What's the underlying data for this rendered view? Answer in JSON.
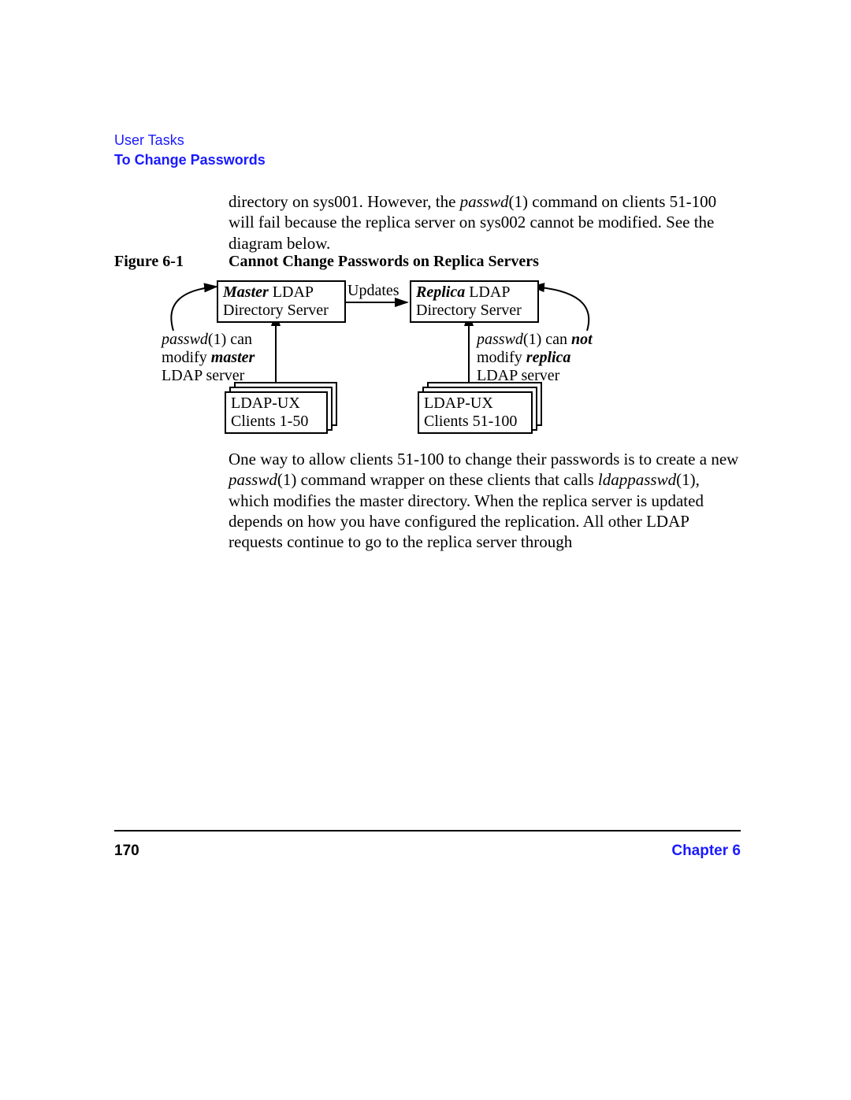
{
  "header": {
    "section": "User Tasks",
    "subsection": "To Change Passwords"
  },
  "paragraph1": {
    "pre": "directory on sys001. However, the ",
    "cmd": "passwd",
    "post_cmd": "(1) command on clients 51-100 will fail because the replica server on sys002 cannot be modified. See the diagram below."
  },
  "figure": {
    "label": "Figure 6-1",
    "caption": "Cannot Change Passwords on Replica Servers"
  },
  "diagram": {
    "master_box": {
      "bold": "Master",
      "rest": " LDAP",
      "line2": "Directory Server"
    },
    "replica_box": {
      "bold": "Replica",
      "rest": " LDAP",
      "line2": "Directory Server"
    },
    "updates": "Updates",
    "left_annot": {
      "l1_cmd": "passwd",
      "l1_rest": "(1) can",
      "l2_pre": "modify ",
      "l2_bold": "master",
      "l3": "LDAP server"
    },
    "right_annot": {
      "l1_cmd": "passwd",
      "l1_mid": "(1) can ",
      "l1_bold": "not",
      "l2_pre": "modify ",
      "l2_bold": "replica",
      "l3": "LDAP server"
    },
    "clients_left": {
      "l1": "LDAP-UX",
      "l2": "Clients 1-50"
    },
    "clients_right": {
      "l1": "LDAP-UX",
      "l2": "Clients 51-100"
    }
  },
  "paragraph2": {
    "p1": "One way to allow clients 51-100 to change their passwords is to create a new ",
    "cmd1": "passwd",
    "p2": "(1) command wrapper on these clients that calls ",
    "cmd2": "ldappasswd",
    "p3": "(1), which modifies the master directory. When the replica server is updated depends on how you have configured the replication. All other LDAP requests continue to go to the replica server through"
  },
  "footer": {
    "page": "170",
    "chapter": "Chapter 6"
  }
}
